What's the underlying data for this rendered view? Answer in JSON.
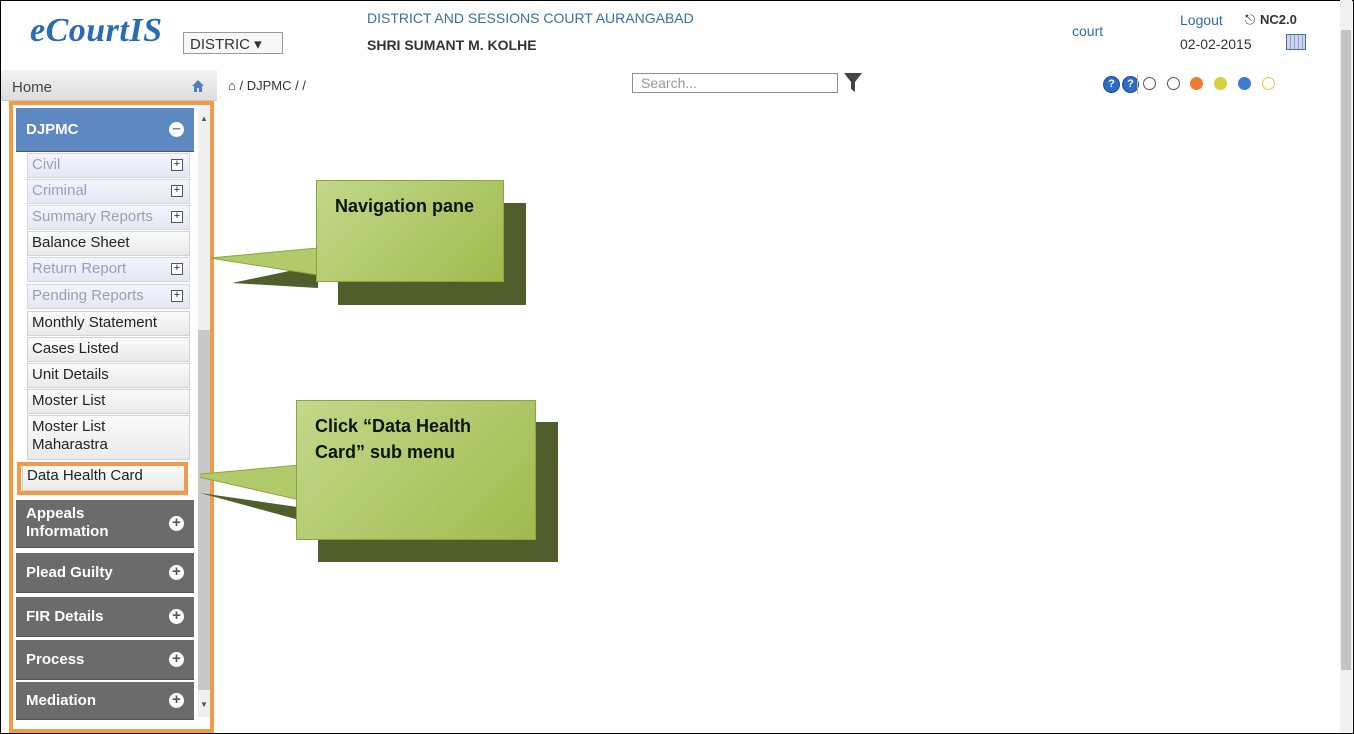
{
  "header": {
    "logo": "eCourtIS",
    "district_select": "DISTRIC ▾",
    "court_name": "DISTRICT AND SESSIONS COURT AURANGABAD",
    "judge_name": "SHRI SUMANT M. KOLHE",
    "user": "court",
    "logout": "Logout",
    "version": "NC2.0",
    "date": "02-02-2015"
  },
  "toolbar": {
    "home": "Home",
    "breadcrumb": "⌂ / DJPMC /  /",
    "search_placeholder": "Search...",
    "help": "?",
    "theme_colors": [
      "#ffffff",
      "#ffffff",
      "#ef7b33",
      "#d8cf3e",
      "#3e7bcd",
      "#ffffff"
    ]
  },
  "sidebar": {
    "open_section": "DJPMC",
    "items": [
      {
        "label": "Civil",
        "expandable": true
      },
      {
        "label": "Criminal",
        "expandable": true
      },
      {
        "label": "Summary Reports",
        "expandable": true
      },
      {
        "label": "Balance Sheet",
        "expandable": false
      },
      {
        "label": "Return Report",
        "expandable": true
      },
      {
        "label": "Pending Reports",
        "expandable": true
      },
      {
        "label": "Monthly Statement",
        "expandable": false
      },
      {
        "label": "Cases Listed",
        "expandable": false
      },
      {
        "label": "Unit Details",
        "expandable": false
      },
      {
        "label": "Moster List",
        "expandable": false
      },
      {
        "label": "Moster List Maharastra",
        "expandable": false
      },
      {
        "label": "Data Health Card",
        "expandable": false
      }
    ],
    "sections": [
      "Appeals Information",
      "Plead Guilty",
      "FIR Details",
      "Process",
      "Mediation"
    ]
  },
  "callouts": {
    "nav_pane": "Navigation pane",
    "data_health": "Click “Data Health Card” sub menu"
  }
}
